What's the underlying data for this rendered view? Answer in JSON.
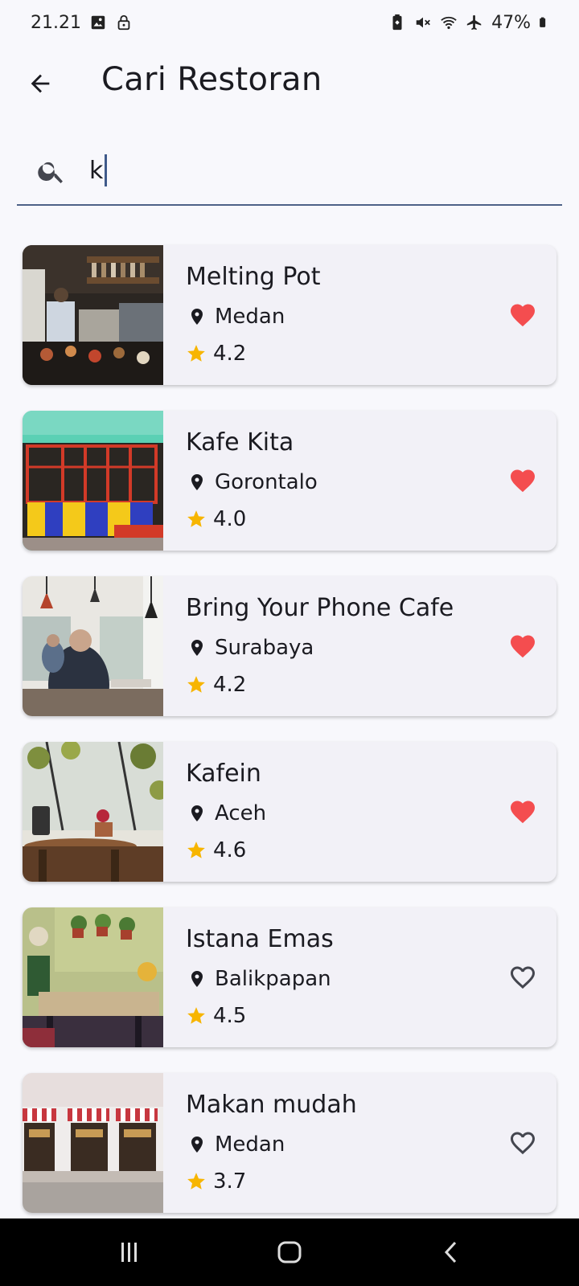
{
  "status_bar": {
    "time": "21.21",
    "battery": "47%"
  },
  "app_bar": {
    "title": "Cari Restoran",
    "back_icon": "arrow-back-icon"
  },
  "search": {
    "value": "k",
    "icon": "search-icon"
  },
  "colors": {
    "favorite": "#f44d4f",
    "star": "#f7b500",
    "search_underline": "#4d6287"
  },
  "restaurants": [
    {
      "name": "Melting Pot",
      "city": "Medan",
      "rating": "4.2",
      "favorite": true
    },
    {
      "name": "Kafe Kita",
      "city": "Gorontalo",
      "rating": "4.0",
      "favorite": true
    },
    {
      "name": "Bring Your Phone Cafe",
      "city": "Surabaya",
      "rating": "4.2",
      "favorite": true
    },
    {
      "name": "Kafein",
      "city": "Aceh",
      "rating": "4.6",
      "favorite": true
    },
    {
      "name": "Istana Emas",
      "city": "Balikpapan",
      "rating": "4.5",
      "favorite": false
    },
    {
      "name": "Makan mudah",
      "city": "Medan",
      "rating": "3.7",
      "favorite": false
    }
  ],
  "nav_bar": {
    "items": [
      "recent-apps-icon",
      "home-icon",
      "back-icon"
    ]
  }
}
